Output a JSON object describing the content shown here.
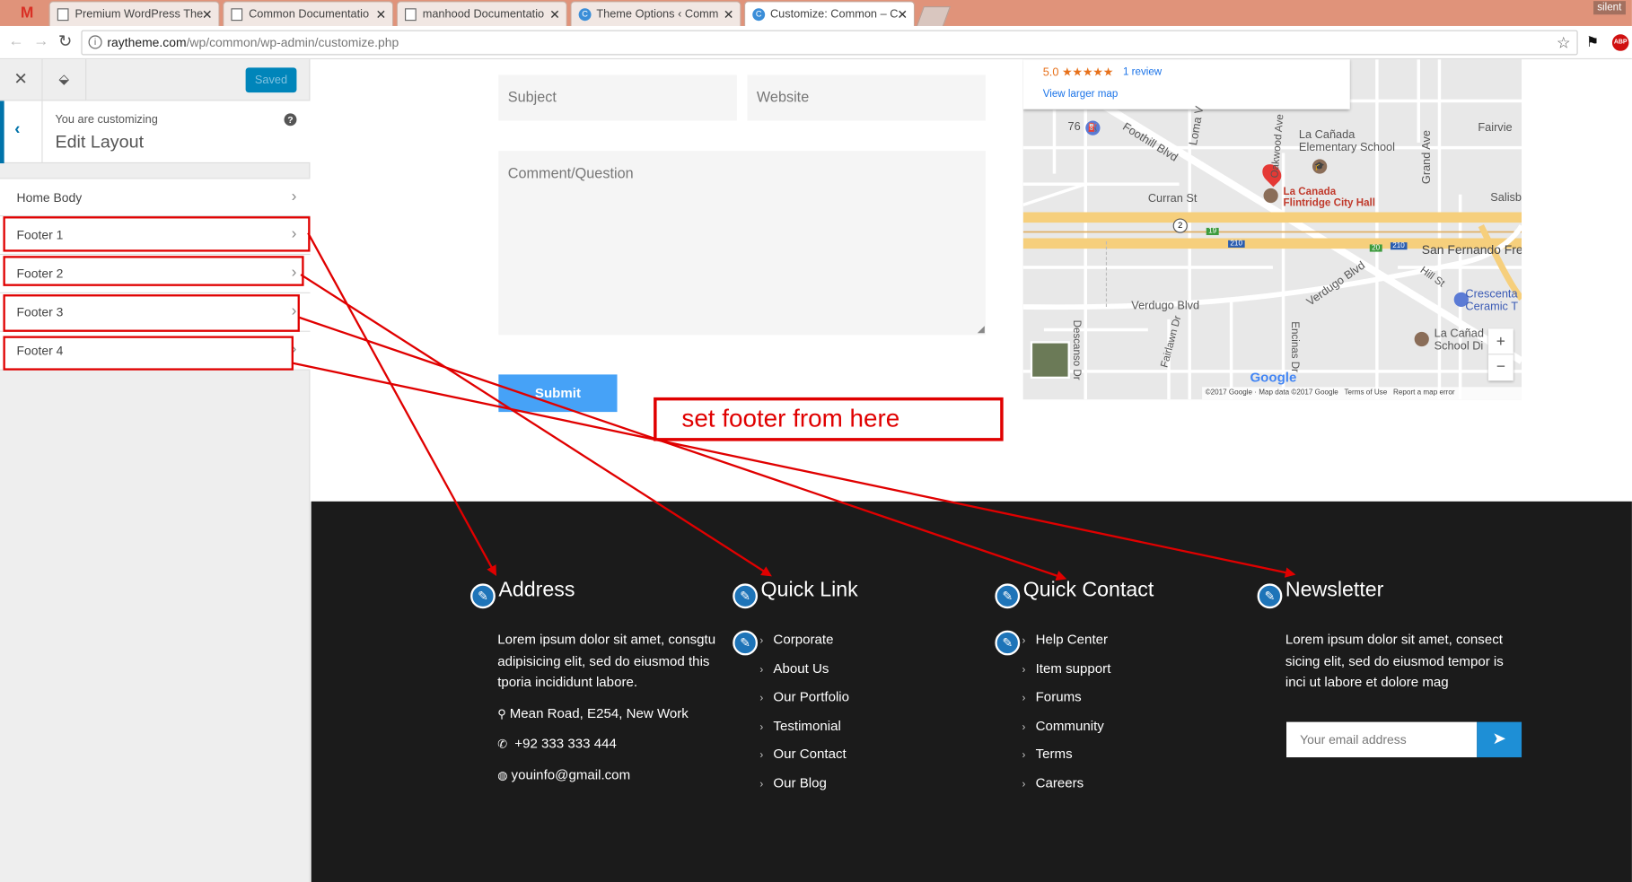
{
  "browser": {
    "tabs": [
      {
        "label": "Premium WordPress The",
        "favicon": "gmail"
      },
      {
        "label": "Common Documentatio"
      },
      {
        "label": "manhood Documentatio"
      },
      {
        "label": "Theme Options ‹ Comm"
      },
      {
        "label": "Customize: Common – C"
      }
    ],
    "gmail_glyph": "M",
    "url_host": "raytheme.com",
    "url_path": "/wp/common/wp-admin/customize.php",
    "profile_badge": "silent",
    "abp_badge": "ABP"
  },
  "customizer": {
    "saved_label": "Saved",
    "customizing_label": "You are customizing",
    "section_title": "Edit Layout",
    "help_glyph": "?",
    "items": [
      {
        "label": "Home Body"
      },
      {
        "label": "Footer 1"
      },
      {
        "label": "Footer 2"
      },
      {
        "label": "Footer 3"
      },
      {
        "label": "Footer 4"
      }
    ]
  },
  "form": {
    "subject_placeholder": "Subject",
    "website_placeholder": "Website",
    "comment_placeholder": "Comment/Question",
    "submit_label": "Submit"
  },
  "annotation": {
    "text": "set footer from here",
    "color": "#e00000"
  },
  "map": {
    "rating": "5.0 ★★★★★",
    "reviews": "1 review",
    "larger_map": "View larger map",
    "labels": {
      "lacanada_school": "La Cañada Elementary School",
      "city_hall": "La Canada Flintridge City Hall",
      "curran": "Curran St",
      "verdugo": "Verdugo Blvd",
      "verdugo2": "Verdugo Blvd",
      "foothill": "Foothill Blvd",
      "san_fernando": "San Fernando Fre",
      "crescenta": "Crescenta Ceramic T",
      "lacanada_school2": "La Cañad School Di",
      "route76": "76",
      "fairview": "Fairvie",
      "salisbury": "Salisb",
      "descanso": "Descanso Dr",
      "fairlawn": "Fairlawn Dr",
      "encinas": "Encinas Dr",
      "hillst": "Hill St",
      "grand": "Grand Ave",
      "loma": "Loma V",
      "oak": "Oakwood Ave",
      "shield210a": "210",
      "shield210b": "210",
      "shield19": "19",
      "shield20": "20",
      "circle2": "2",
      "plus": "+",
      "minus": "−"
    },
    "google": "Google",
    "credits": "©2017 Google · Map data ©2017 Google",
    "terms": "Terms of Use",
    "report": "Report a map error"
  },
  "footer": {
    "address": {
      "title": "Address",
      "text": "Lorem ipsum dolor sit amet, consgtu adipisicing elit, sed do eiusmod this tporia incididunt labore.",
      "location": "Mean Road, E254, New Work",
      "phone": "+92 333 333 444",
      "email": "youinfo@gmail.com"
    },
    "quick_link": {
      "title": "Quick Link",
      "items": [
        "Corporate",
        "About Us",
        "Our Portfolio",
        "Testimonial",
        "Our Contact",
        "Our Blog"
      ]
    },
    "quick_contact": {
      "title": "Quick Contact",
      "items": [
        "Help Center",
        "Item support",
        "Forums",
        "Community",
        "Terms",
        "Careers"
      ]
    },
    "newsletter": {
      "title": "Newsletter",
      "text": "Lorem ipsum dolor sit amet, consect sicing elit, sed do eiusmod tempor is inci ut labore et dolore mag",
      "email_placeholder": "Your email address"
    }
  }
}
